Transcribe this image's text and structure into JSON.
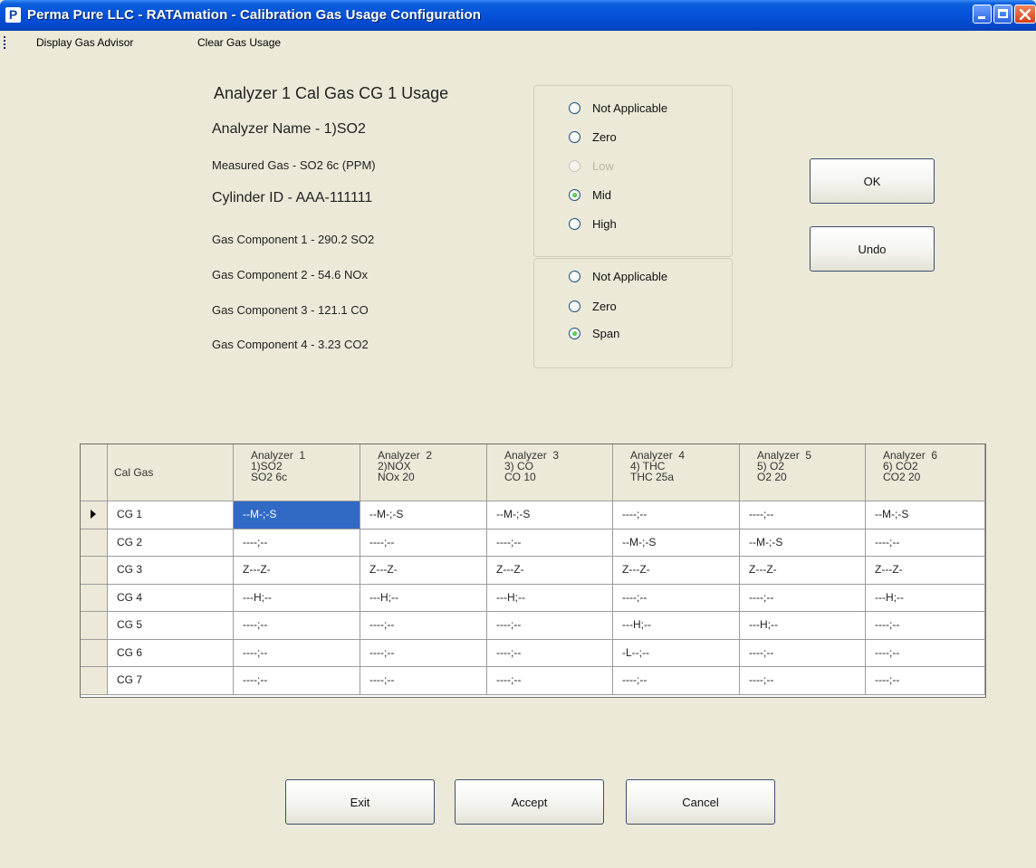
{
  "window": {
    "title": "Perma Pure LLC - RATAmation - Calibration Gas Usage Configuration",
    "app_icon": "P"
  },
  "menu": {
    "items": [
      "Display Gas Advisor",
      "Clear Gas Usage"
    ]
  },
  "info": {
    "heading": "Analyzer  1 Cal Gas CG 1 Usage",
    "analyzer_name": "Analyzer Name - 1)SO2",
    "measured_gas": "Measured Gas - SO2 6c (PPM)",
    "cylinder_id": "Cylinder ID - AAA-111111",
    "components": [
      "Gas Component 1  -  290.2   SO2",
      "Gas Component 2  -  54.6   NOx",
      "Gas Component 3  -  121.1   CO",
      "Gas Component 4  -  3.23   CO2"
    ]
  },
  "level_options": [
    {
      "label": "Not Applicable",
      "checked": false,
      "disabled": false
    },
    {
      "label": "Zero",
      "checked": false,
      "disabled": false
    },
    {
      "label": "Low",
      "checked": false,
      "disabled": true
    },
    {
      "label": "Mid",
      "checked": true,
      "disabled": false
    },
    {
      "label": "High",
      "checked": false,
      "disabled": false
    }
  ],
  "span_options": [
    {
      "label": "Not Applicable",
      "checked": false
    },
    {
      "label": "Zero",
      "checked": false
    },
    {
      "label": "Span",
      "checked": true
    }
  ],
  "buttons": {
    "ok": "OK",
    "undo": "Undo",
    "exit": "Exit",
    "accept": "Accept",
    "cancel": "Cancel"
  },
  "grid": {
    "header_first": "Cal Gas",
    "columns": [
      "Analyzer  1\n1)SO2\nSO2 6c",
      "Analyzer  2\n2)NOX\nNOx 20",
      "Analyzer  3\n3) CO\nCO 10",
      "Analyzer  4\n4) THC\nTHC 25a",
      "Analyzer  5\n5) O2\nO2 20",
      "Analyzer  6\n6) CO2\nCO2 20"
    ],
    "rows": [
      {
        "label": "CG 1",
        "cells": [
          "--M-;-S",
          "--M-;-S",
          "--M-;-S",
          "----;--",
          "----;--",
          "--M-;-S"
        ]
      },
      {
        "label": "CG 2",
        "cells": [
          "----;--",
          "----;--",
          "----;--",
          "--M-;-S",
          "--M-;-S",
          "----;--"
        ]
      },
      {
        "label": "CG 3",
        "cells": [
          "Z---Z-",
          "Z---Z-",
          "Z---Z-",
          "Z---Z-",
          "Z---Z-",
          "Z---Z-"
        ]
      },
      {
        "label": "CG 4",
        "cells": [
          "---H;--",
          "---H;--",
          "---H;--",
          "----;--",
          "----;--",
          "---H;--"
        ]
      },
      {
        "label": "CG 5",
        "cells": [
          "----;--",
          "----;--",
          "----;--",
          "---H;--",
          "---H;--",
          "----;--"
        ]
      },
      {
        "label": "CG 6",
        "cells": [
          "----;--",
          "----;--",
          "----;--",
          "-L--;--",
          "----;--",
          "----;--"
        ]
      },
      {
        "label": "CG 7",
        "cells": [
          "----;--",
          "----;--",
          "----;--",
          "----;--",
          "----;--",
          "----;--"
        ]
      }
    ],
    "current_row": 0,
    "selected_cell": [
      0,
      0
    ]
  }
}
